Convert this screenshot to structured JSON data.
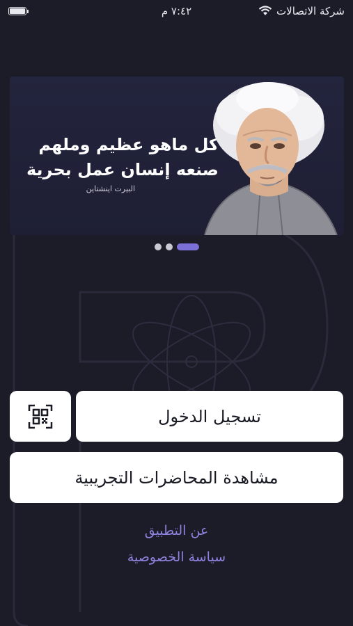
{
  "status_bar": {
    "carrier": "شركة الاتصالات",
    "time": "٧:٤٢ م",
    "battery_level": 1.0,
    "wifi_icon": "wifi-icon",
    "battery_icon": "battery-icon"
  },
  "banner": {
    "quote": "كل ماهو عظيم وملهم صنعه إنسان عمل بحرية",
    "author": "البيرت اينشتاين",
    "image": "einstein-portrait"
  },
  "carousel": {
    "pages": 3,
    "active_index": 2
  },
  "buttons": {
    "login": "تسجيل الدخول",
    "qr_icon": "qr-scan-icon",
    "demo_lectures": "مشاهدة المحاضرات التجريبية"
  },
  "links": {
    "about": "عن التطبيق",
    "privacy": "سياسة الخصوصية"
  },
  "colors": {
    "background": "#1c1b28",
    "accent": "#7b6fd8",
    "link": "#8d84e0",
    "button_bg": "#ffffff"
  }
}
